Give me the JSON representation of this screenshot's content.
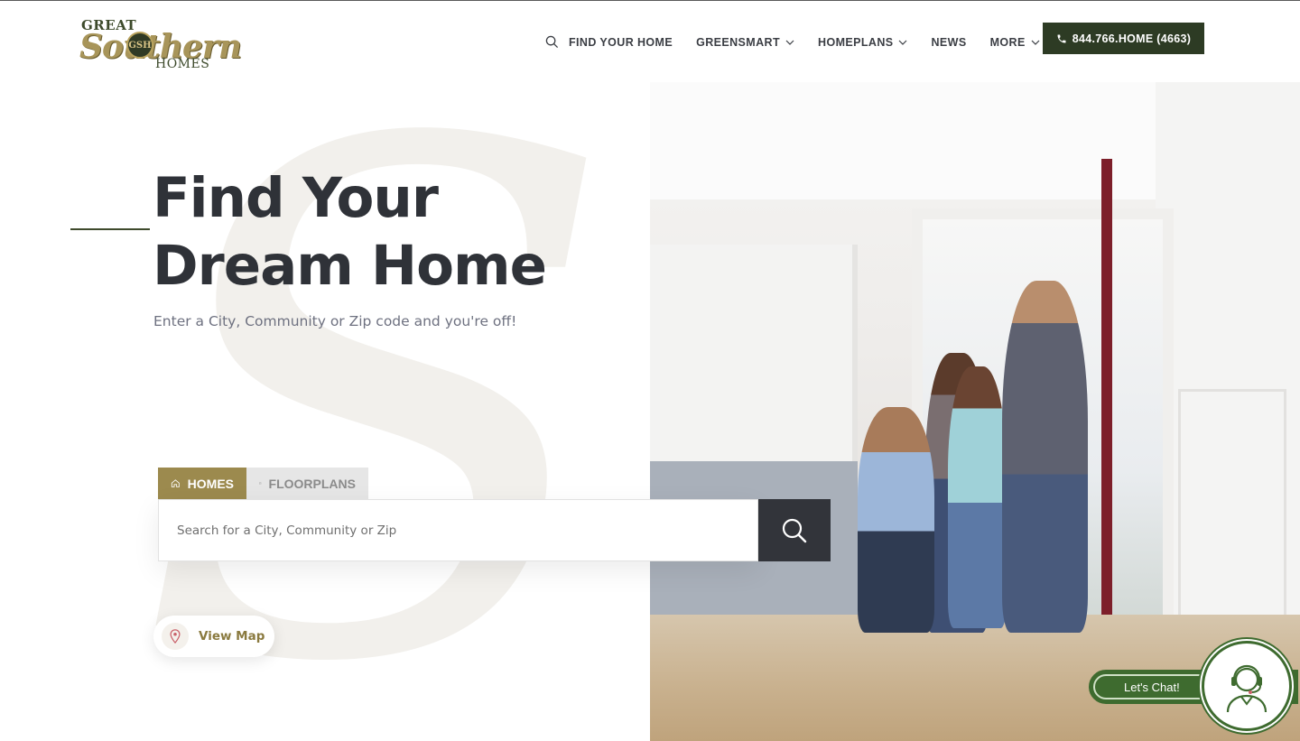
{
  "logo": {
    "line1": "GREAT",
    "line2": "Southern",
    "line3": "HOMES",
    "crest": "GSH"
  },
  "nav": {
    "items": [
      {
        "label": "FIND YOUR HOME",
        "icon": "search-icon"
      },
      {
        "label": "GREENSMART",
        "icon": "chevron-down-icon"
      },
      {
        "label": "HOMEPLANS",
        "icon": "chevron-down-icon"
      },
      {
        "label": "NEWS"
      },
      {
        "label": "MORE",
        "icon": "chevron-down-icon"
      }
    ],
    "phone_label": "844.766.HOME (4663)"
  },
  "hero": {
    "title_line1": "Find Your",
    "title_line2": "Dream Home",
    "subtitle": "Enter a City, Community or Zip code and you're off!"
  },
  "search": {
    "tabs": [
      {
        "label": "HOMES",
        "icon": "home-icon",
        "active": true
      },
      {
        "label": "FLOORPLANS",
        "icon": "floorplan-icon",
        "active": false
      }
    ],
    "placeholder": "Search for a City, Community or Zip",
    "view_map_label": "View Map"
  },
  "chat": {
    "label": "Let's Chat!"
  },
  "colors": {
    "brand_dark_green": "#2d3b24",
    "brand_gold": "#9c8a4e",
    "text_dark": "#2f3238",
    "search_button": "#32343a",
    "chat_green": "#3e6b2f"
  }
}
